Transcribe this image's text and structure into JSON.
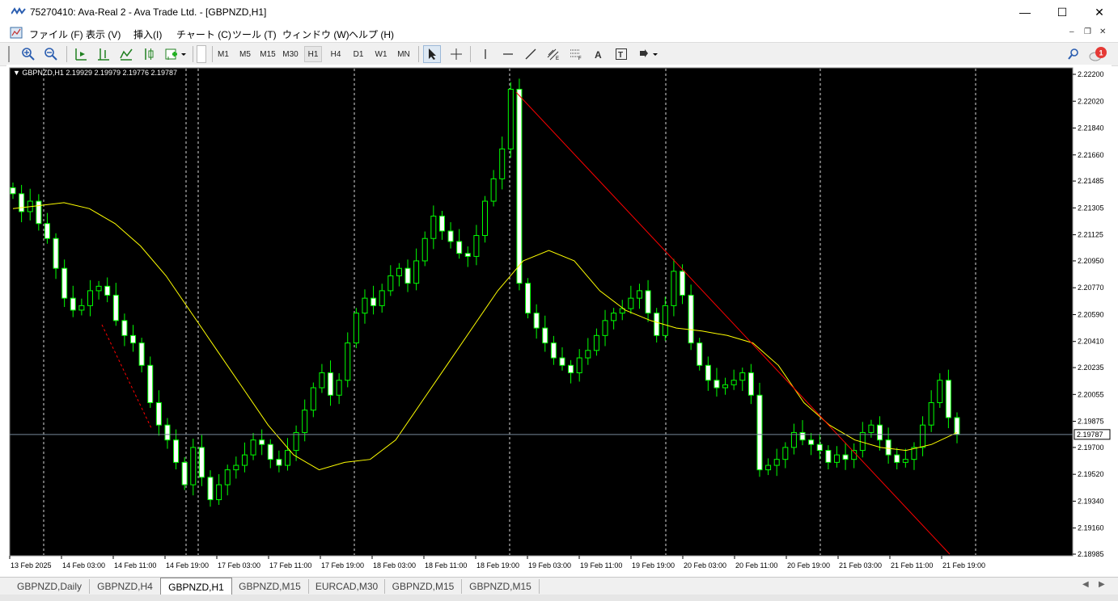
{
  "window": {
    "title": "75270410: Ava-Real 2 - Ava Trade Ltd. - [GBPNZD,H1]",
    "minimize": "—",
    "maximize": "☐",
    "close": "✕"
  },
  "menu": {
    "items": [
      "ファイル (F)",
      "表示 (V)",
      "挿入(I)",
      "チャート (C)",
      "ツール (T)",
      "ウィンドウ (W)",
      "ヘルプ (H)"
    ],
    "mdi_min": "–",
    "mdi_restore": "❐",
    "mdi_close": "✕"
  },
  "toolbar": {
    "timeframes": [
      "M1",
      "M5",
      "M15",
      "M30",
      "H1",
      "H4",
      "D1",
      "W1",
      "MN"
    ],
    "active_timeframe": "H1",
    "notification_count": "1"
  },
  "chart": {
    "symbol_label": "GBPNZD,H1  2.19929 2.19979 2.19776 2.19787",
    "current_price": "2.19787",
    "price_labels": [
      "2.22200",
      "2.22020",
      "2.21840",
      "2.21660",
      "2.21485",
      "2.21305",
      "2.21125",
      "2.20950",
      "2.20770",
      "2.20590",
      "2.20410",
      "2.20235",
      "2.20055",
      "2.19875",
      "2.19700",
      "2.19520",
      "2.19340",
      "2.19160",
      "2.18985"
    ],
    "time_labels": [
      "13 Feb 2025",
      "14 Feb 03:00",
      "14 Feb 11:00",
      "14 Feb 19:00",
      "17 Feb 03:00",
      "17 Feb 11:00",
      "17 Feb 19:00",
      "18 Feb 03:00",
      "18 Feb 11:00",
      "18 Feb 19:00",
      "19 Feb 03:00",
      "19 Feb 11:00",
      "19 Feb 19:00",
      "20 Feb 03:00",
      "20 Feb 11:00",
      "20 Feb 19:00",
      "21 Feb 03:00",
      "21 Feb 11:00",
      "21 Feb 19:00"
    ],
    "colors": {
      "background": "#000000",
      "candle": "#00ff00",
      "candle_bull_body": "#000000",
      "candle_bear_body": "#ffffff",
      "moving_average": "#ffff00",
      "trendline": "#ff0000",
      "grid_separator": "#ffffff",
      "bid_line": "#778899"
    }
  },
  "chart_data": {
    "type": "candlestick",
    "symbol": "GBPNZD",
    "timeframe": "H1",
    "ylim": [
      2.18985,
      2.222
    ],
    "ohlc_last": {
      "open": 2.19929,
      "high": 2.19979,
      "low": 2.19776,
      "close": 2.19787
    },
    "close_series": [
      2.214,
      2.2128,
      2.2135,
      2.212,
      2.211,
      2.209,
      2.207,
      2.2062,
      2.2065,
      2.2075,
      2.2078,
      2.2072,
      2.2055,
      2.2045,
      2.204,
      2.2025,
      2.2,
      2.1985,
      2.1975,
      2.196,
      2.1945,
      2.197,
      2.195,
      2.1935,
      2.1945,
      2.1955,
      2.1958,
      2.1965,
      2.1975,
      2.1972,
      2.1962,
      2.1958,
      2.1968,
      2.198,
      2.1995,
      2.201,
      2.202,
      2.2005,
      2.2015,
      2.204,
      2.206,
      2.207,
      2.2065,
      2.2075,
      2.2085,
      2.209,
      2.208,
      2.2095,
      2.211,
      2.2125,
      2.2115,
      2.2108,
      2.21,
      2.2098,
      2.2112,
      2.2135,
      2.215,
      2.217,
      2.221,
      2.208,
      2.206,
      2.205,
      2.204,
      2.203,
      2.2025,
      2.202,
      2.203,
      2.2035,
      2.2045,
      2.2055,
      2.206,
      2.2063,
      2.207,
      2.2075,
      2.206,
      2.2045,
      2.2065,
      2.2088,
      2.2072,
      2.204,
      2.2025,
      2.2015,
      2.201,
      2.2012,
      2.2015,
      2.202,
      2.2005,
      2.1955,
      2.1958,
      2.1962,
      2.197,
      2.198,
      2.1975,
      2.1972,
      2.1968,
      2.196,
      2.1965,
      2.1962,
      2.1968,
      2.198,
      2.1985,
      2.1975,
      2.1965,
      2.196,
      2.1962,
      2.197,
      2.1985,
      2.2,
      2.2015,
      2.199,
      2.19787
    ],
    "moving_average": [
      2.213,
      2.2132,
      2.2134,
      2.213,
      2.212,
      2.2105,
      2.2085,
      2.206,
      2.2035,
      2.201,
      2.1985,
      2.1965,
      2.1955,
      2.196,
      2.1962,
      2.1975,
      2.2,
      2.2025,
      2.205,
      2.2075,
      2.2095,
      2.2102,
      2.2095,
      2.2075,
      2.2062,
      2.2055,
      2.205,
      2.2048,
      2.2045,
      2.204,
      2.2025,
      2.2,
      2.1985,
      2.1975,
      2.197,
      2.1968,
      2.1972,
      2.198
    ],
    "trendline": {
      "from": {
        "time": "18 Feb 20:00",
        "price": 2.2208
      },
      "to": {
        "time": "21 Feb 19:00",
        "price": 2.18985
      }
    },
    "xlabel": "",
    "ylabel": ""
  },
  "tabs": [
    "GBPNZD,Daily",
    "GBPNZD,H4",
    "GBPNZD,H1",
    "GBPNZD,M15",
    "EURCAD,M30",
    "GBPNZD,M15",
    "GBPNZD,M15"
  ],
  "active_tab": "GBPNZD,H1"
}
